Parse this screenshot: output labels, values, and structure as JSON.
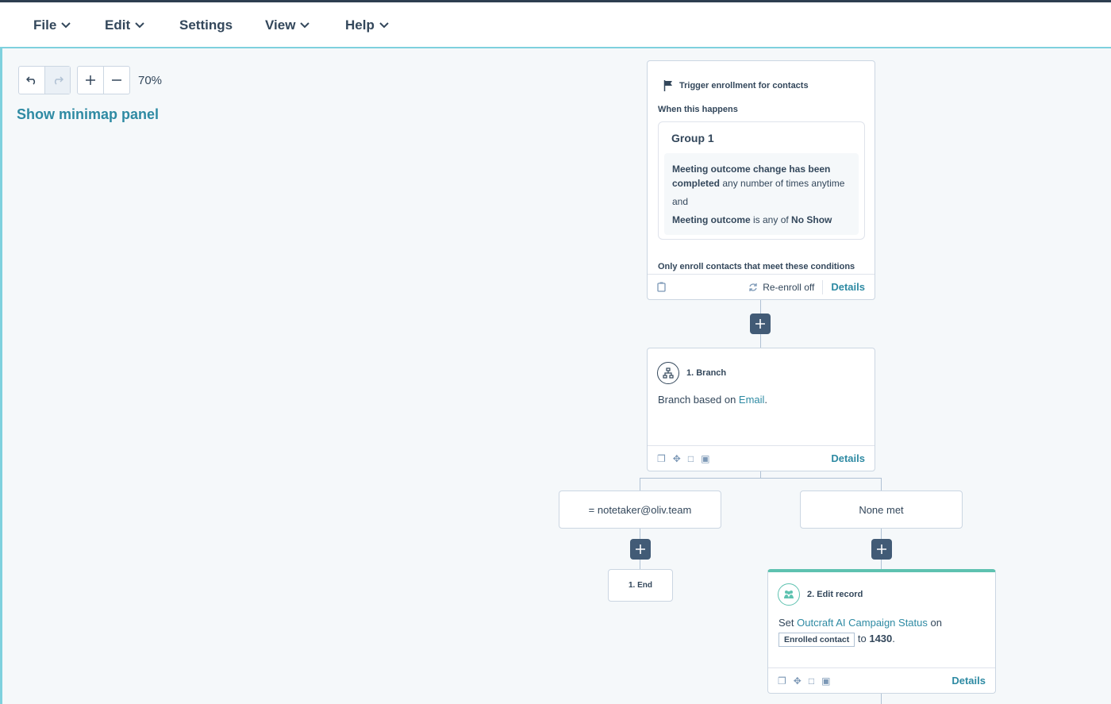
{
  "menu": {
    "file": "File",
    "edit": "Edit",
    "settings": "Settings",
    "view": "View",
    "help": "Help"
  },
  "toolbar": {
    "zoom_level": "70%",
    "minimap_link": "Show minimap panel"
  },
  "trigger": {
    "title": "Trigger enrollment for contacts",
    "when_label": "When this happens",
    "group_title": "Group 1",
    "cond1_bold": "Meeting outcome change has been completed",
    "cond1_rest": " any number of times anytime",
    "and_label": "and",
    "cond2_bold": "Meeting outcome",
    "cond2_mid": " is any of ",
    "cond2_value": "No Show",
    "only_enroll": "Only enroll contacts that meet these conditions",
    "reenroll": "Re-enroll off",
    "details": "Details"
  },
  "branch": {
    "title": "1. Branch",
    "text_prefix": "Branch based on ",
    "text_link": "Email",
    "text_suffix": ".",
    "details": "Details"
  },
  "branches": {
    "left_label": "= notetaker@oliv.team",
    "right_label": "None met"
  },
  "end_node": {
    "label": "1. End"
  },
  "edit_record": {
    "title": "2. Edit record",
    "set_word": "Set ",
    "property_link": "Outcraft AI Campaign Status",
    "on_word": " on",
    "chip": "Enrolled contact",
    "to_word": " to ",
    "value": "1430",
    "period": ".",
    "details": "Details",
    "accent_color": "#5ec2b0"
  }
}
